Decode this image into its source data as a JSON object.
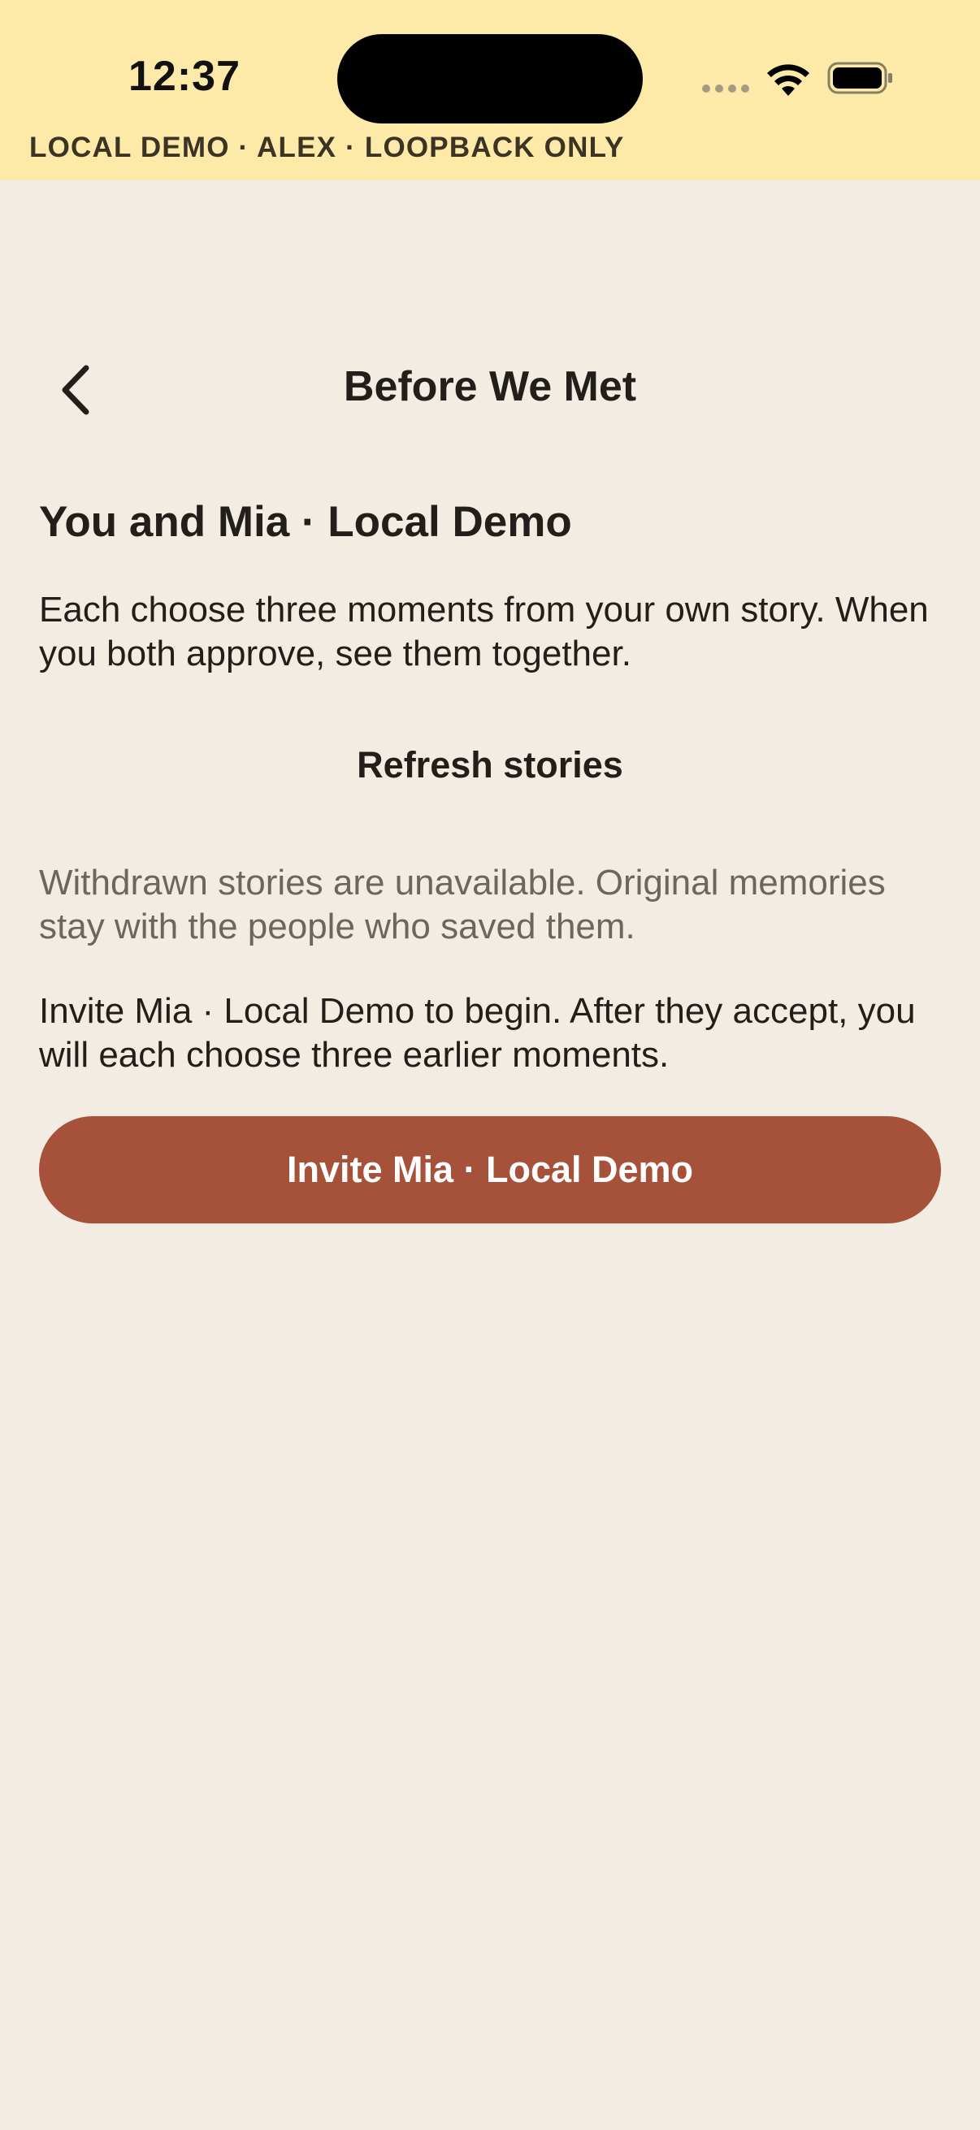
{
  "status_bar": {
    "time": "12:37",
    "icons": [
      "signal-dots-icon",
      "wifi-icon",
      "battery-icon"
    ]
  },
  "banner": {
    "label": "LOCAL DEMO · ALEX · LOOPBACK ONLY",
    "color": "#fdeaa9"
  },
  "nav": {
    "back_icon": "chevron-left-icon",
    "title": "Before We Met"
  },
  "content": {
    "heading": "You and Mia · Local Demo",
    "intro": "Each choose three moments from your own story. When you both approve, see them together.",
    "refresh_label": "Refresh stories",
    "withdrawn_note": "Withdrawn stories are unavailable. Original memories stay with the people who saved them.",
    "invite_prompt": "Invite Mia · Local Demo to begin. After they accept, you will each choose three earlier moments.",
    "invite_button_label": "Invite Mia · Local Demo"
  },
  "colors": {
    "background": "#f3ece3",
    "accent": "#a6513a",
    "text": "#221f1b",
    "muted": "#6b6660"
  }
}
